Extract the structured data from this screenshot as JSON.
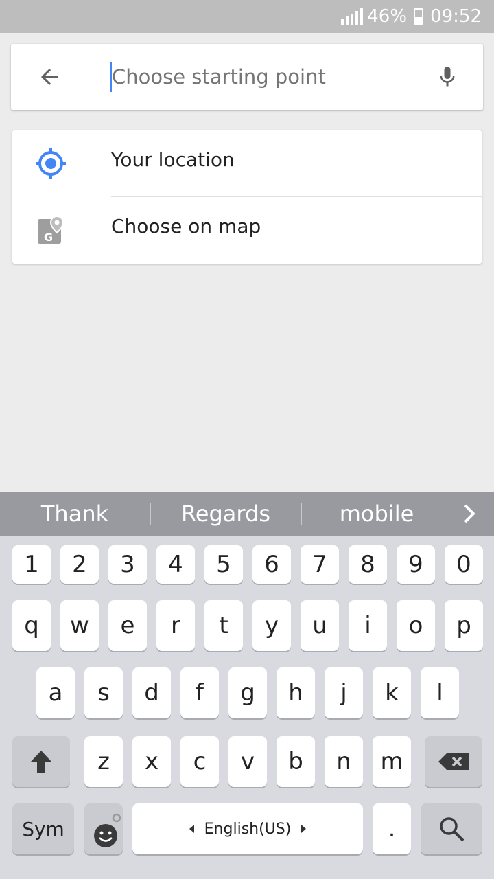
{
  "status_bar": {
    "battery_percent": "46%",
    "time": "09:52"
  },
  "search": {
    "placeholder": "Choose starting point"
  },
  "suggestions": [
    {
      "label": "Your location",
      "icon": "my-location-icon"
    },
    {
      "label": "Choose on map",
      "icon": "map-pin-icon"
    }
  ],
  "predictions": [
    "Thank",
    "Regards",
    "mobile"
  ],
  "keyboard": {
    "row_numbers": [
      "1",
      "2",
      "3",
      "4",
      "5",
      "6",
      "7",
      "8",
      "9",
      "0"
    ],
    "row1": [
      "q",
      "w",
      "e",
      "r",
      "t",
      "y",
      "u",
      "i",
      "o",
      "p"
    ],
    "row2": [
      "a",
      "s",
      "d",
      "f",
      "g",
      "h",
      "j",
      "k",
      "l"
    ],
    "row3": [
      "z",
      "x",
      "c",
      "v",
      "b",
      "n",
      "m"
    ],
    "sym_label": "Sym",
    "space_label": "English(US)",
    "period_label": "."
  },
  "colors": {
    "accent": "#4285f4",
    "keyboard_bg": "#d8dae0",
    "prediction_bg": "#999aa0"
  }
}
